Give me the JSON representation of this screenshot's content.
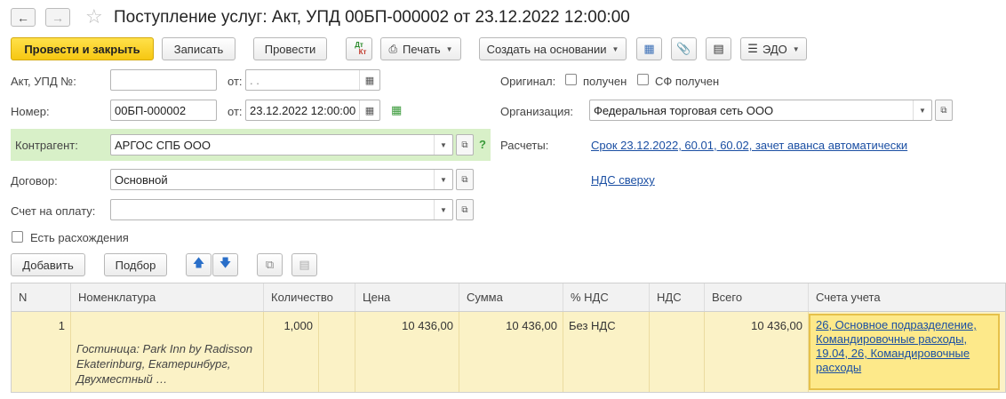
{
  "window": {
    "title": "Поступление услуг: Акт, УПД 00БП-000002 от 23.12.2022 12:00:00"
  },
  "toolbar": {
    "post_close": "Провести и закрыть",
    "save": "Записать",
    "post": "Провести",
    "dtkt": "Дт Кт",
    "print": "Печать",
    "create_based": "Создать на основании",
    "edo": "ЭДО"
  },
  "form": {
    "act_label": "Акт, УПД №:",
    "act_value": "",
    "from_label": "от:",
    "act_date": " .  .",
    "number_label": "Номер:",
    "number_value": "00БП-000002",
    "number_date": "23.12.2022 12:00:00",
    "counterparty_label": "Контрагент:",
    "counterparty_value": "АРГОС СПБ ООО",
    "help": "?",
    "contract_label": "Договор:",
    "contract_value": "Основной",
    "invoice_label": "Счет на оплату:",
    "invoice_value": "",
    "discrepancy_label": "Есть расхождения",
    "original_label": "Оригинал:",
    "received_label": "получен",
    "sf_received_label": "СФ получен",
    "organization_label": "Организация:",
    "organization_value": "Федеральная торговая сеть ООО",
    "settlements_label": "Расчеты:",
    "settlements_link": "Срок 23.12.2022, 60.01, 60.02, зачет аванса автоматически",
    "vat_link": "НДС сверху"
  },
  "table_toolbar": {
    "add": "Добавить",
    "pick": "Подбор"
  },
  "table": {
    "headers": [
      "N",
      "Номенклатура",
      "Количество",
      "Цена",
      "Сумма",
      "% НДС",
      "НДС",
      "Всего",
      "Счета учета"
    ],
    "rows": [
      {
        "n": "1",
        "item_note": "Гостиница: Park Inn by Radisson Ekaterinburg, Екатеринбург, Двухместный …",
        "qty": "1,000",
        "price": "10 436,00",
        "sum": "10 436,00",
        "vat_rate": "Без НДС",
        "vat": "",
        "total": "10 436,00",
        "accounts": "26, Основное подразделение, Командировочные расходы, 19.04, 26, Командировочные расходы"
      }
    ]
  },
  "colors": {
    "primary_button": "#f6c712",
    "counterparty_highlight": "#d8f0c8",
    "row_highlight": "#fbf2c6",
    "link": "#1b4fa3"
  }
}
